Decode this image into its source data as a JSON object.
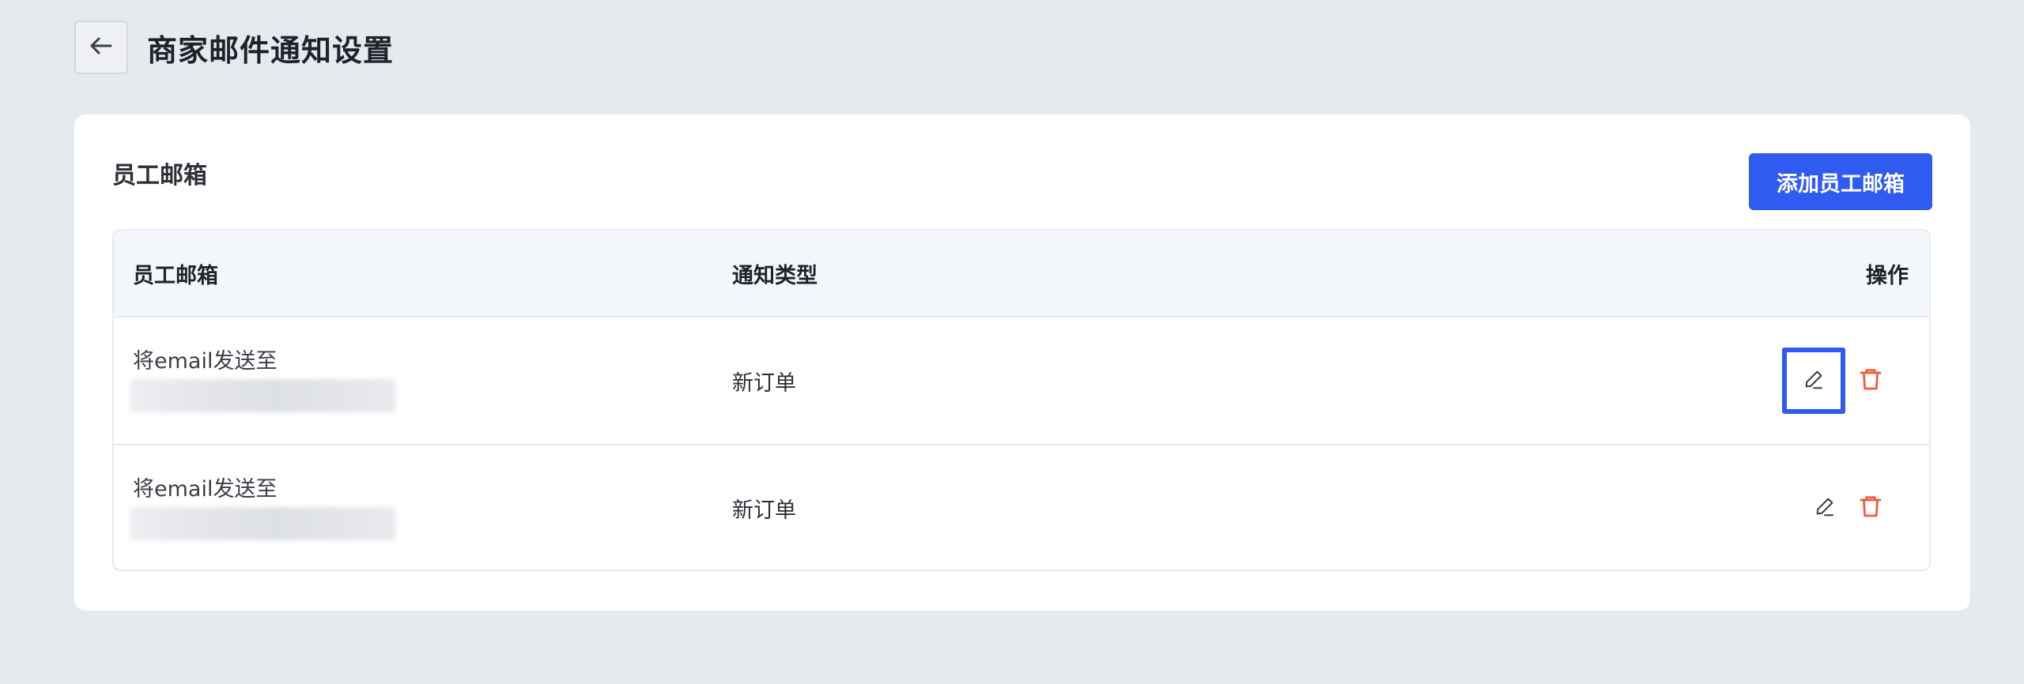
{
  "header": {
    "back_icon": "arrow-left-icon",
    "title": "商家邮件通知设置"
  },
  "section": {
    "title": "员工邮箱",
    "add_button_label": "添加员工邮箱",
    "accent_color": "#2f5bf0",
    "delete_color": "#f05a3a"
  },
  "table": {
    "columns": [
      "员工邮箱",
      "通知类型",
      "操作"
    ],
    "rows": [
      {
        "email_prefix": "将email发送至",
        "notify_type": "新订单",
        "edit_icon": "pencil-icon",
        "delete_icon": "trash-icon",
        "edit_focused": true
      },
      {
        "email_prefix": "将email发送至",
        "notify_type": "新订单",
        "edit_icon": "pencil-icon",
        "delete_icon": "trash-icon",
        "edit_focused": false
      }
    ]
  }
}
